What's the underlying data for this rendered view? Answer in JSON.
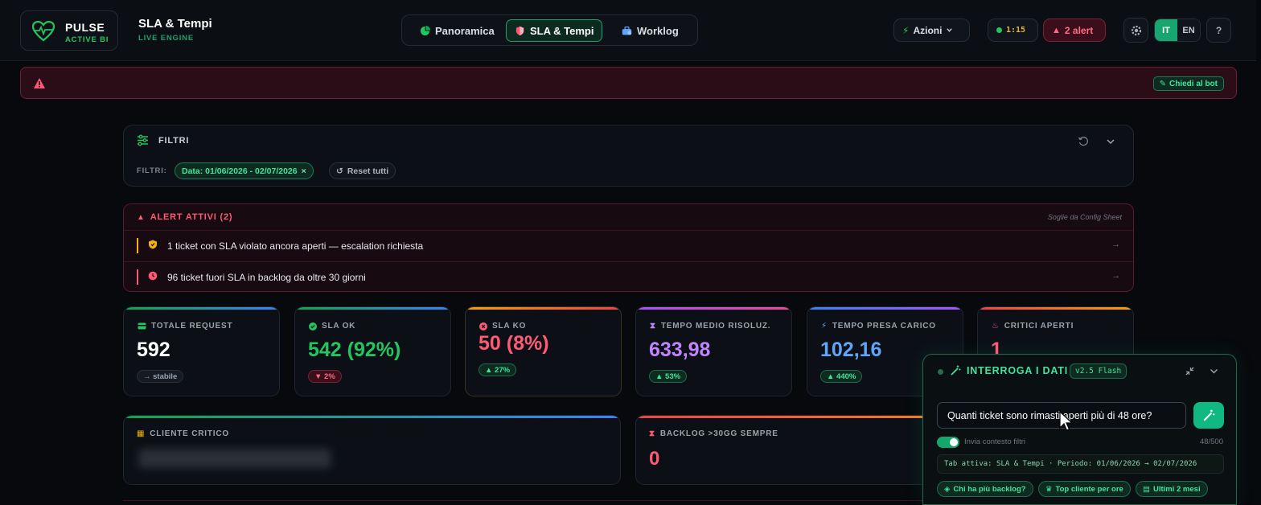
{
  "header": {
    "brand_name": "PULSE",
    "brand_sub": "ACTIVE BI",
    "page_title": "SLA & Tempi",
    "page_sub": "LIVE ENGINE",
    "tabs": [
      {
        "label": "Panoramica",
        "icon": "pie-chart-icon"
      },
      {
        "label": "SLA & Tempi",
        "icon": "shield-icon",
        "active": true
      },
      {
        "label": "Worklog",
        "icon": "briefcase-icon"
      }
    ],
    "actions_label": "Azioni",
    "timer": "1:15",
    "alert_count_label": "2 alert",
    "lang_it": "IT",
    "lang_en": "EN",
    "help": "?"
  },
  "banner": {
    "bot_button": "Chiedi al bot"
  },
  "filters": {
    "title": "FILTRI",
    "label": "FILTRI:",
    "date_chip": "Data: 01/06/2026 - 02/07/2026",
    "reset": "Reset tutti"
  },
  "alerts": {
    "title": "ALERT ATTIVI (2)",
    "note": "Soglie da Config Sheet",
    "items": [
      {
        "text": "1 ticket con SLA violato ancora aperti — escalation richiesta",
        "color": "#f5b30b"
      },
      {
        "text": "96 ticket fuori SLA in backlog da oltre 30 giorni",
        "color": "#ff5a74"
      }
    ]
  },
  "kpis": [
    {
      "label": "TOTALE REQUEST",
      "value": "592",
      "badge": "→ stabile",
      "color": "#ffffff"
    },
    {
      "label": "SLA OK",
      "value": "542 (92%)",
      "badge": "▼ 2%",
      "color": "#22c55e"
    },
    {
      "label": "SLA KO",
      "value": "50 (8%)",
      "badge": "▲ 27%",
      "color": "#ff5a74"
    },
    {
      "label": "TEMPO MEDIO RISOLUZ.",
      "value": "633,98",
      "badge": "▲ 53%",
      "color": "#c084fc"
    },
    {
      "label": "TEMPO PRESA CARICO",
      "value": "102,16",
      "badge": "▲ 440%",
      "color": "#60a5fa"
    },
    {
      "label": "CRITICI APERTI",
      "value": "1",
      "badge": "",
      "color": "#ff5a74"
    }
  ],
  "cliente_critico": {
    "label": "CLIENTE CRITICO"
  },
  "backlog": {
    "label": "BACKLOG >30GG SEMPRE",
    "value": "0"
  },
  "query": {
    "title": "INTERROGA I DATI",
    "version": "v2.5 Flash",
    "input_value": "Quanti ticket sono rimasti aperti più di 48 ore?",
    "toggle_label": "Invia contesto filtri",
    "count": "48/500",
    "context": "Tab attiva: SLA & Tempi · Periodo: 01/06/2026 → 02/07/2026",
    "suggestions": [
      "Chi ha più backlog?",
      "Top cliente per ore",
      "Ultimi 2 mesi"
    ]
  }
}
